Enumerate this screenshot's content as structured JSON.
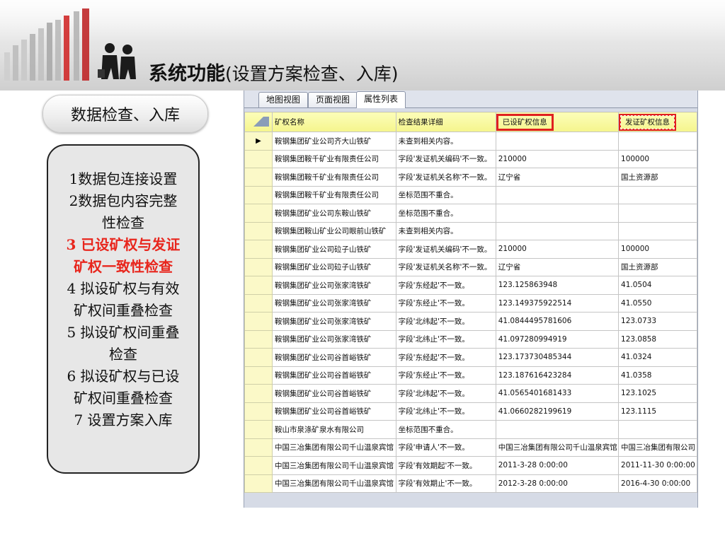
{
  "slide": {
    "title_bold": "系统功能",
    "title_rest": "(设置方案检查、入库)"
  },
  "section": {
    "label": "数据检查、入库"
  },
  "steps": [
    {
      "text": "1数据包连接设置",
      "highlight": false
    },
    {
      "text": "2数据包内容完整",
      "highlight": false
    },
    {
      "text": "性检查",
      "highlight": false
    },
    {
      "text": "3 已设矿权与发证",
      "highlight": true
    },
    {
      "text": "矿权一致性检查",
      "highlight": true
    },
    {
      "text": "4 拟设矿权与有效",
      "highlight": false
    },
    {
      "text": "矿权间重叠检查",
      "highlight": false
    },
    {
      "text": "5 拟设矿权间重叠",
      "highlight": false
    },
    {
      "text": "检查",
      "highlight": false
    },
    {
      "text": "6 拟设矿权与已设",
      "highlight": false
    },
    {
      "text": "矿权间重叠检查",
      "highlight": false
    },
    {
      "text": "7 设置方案入库",
      "highlight": false
    }
  ],
  "tabs": [
    {
      "label": "地图视图",
      "active": false
    },
    {
      "label": "页面视图",
      "active": false
    },
    {
      "label": "属性列表",
      "active": true
    }
  ],
  "table": {
    "columns": [
      "矿权名称",
      "检查结果详细",
      "已设矿权信息",
      "发证矿权信息"
    ],
    "current_row_marker": "▶",
    "rows": [
      [
        "鞍钢集团矿业公司齐大山铁矿",
        "未查到相关内容。",
        "",
        ""
      ],
      [
        "鞍钢集团鞍千矿业有限责任公司",
        "字段'发证机关编码'不一致。",
        "210000",
        "100000"
      ],
      [
        "鞍钢集团鞍千矿业有限责任公司",
        "字段'发证机关名称'不一致。",
        "辽宁省",
        "国土资源部"
      ],
      [
        "鞍钢集团鞍千矿业有限责任公司",
        "坐标范围不重合。",
        "",
        ""
      ],
      [
        "鞍钢集团矿业公司东鞍山铁矿",
        "坐标范围不重合。",
        "",
        ""
      ],
      [
        "鞍钢集团鞍山矿业公司眼前山铁矿",
        "未查到相关内容。",
        "",
        ""
      ],
      [
        "鞍钢集团矿业公司砬子山铁矿",
        "字段'发证机关编码'不一致。",
        "210000",
        "100000"
      ],
      [
        "鞍钢集团矿业公司砬子山铁矿",
        "字段'发证机关名称'不一致。",
        "辽宁省",
        "国土资源部"
      ],
      [
        "鞍钢集团矿业公司张家湾铁矿",
        "字段'东经起'不一致。",
        "123.125863948",
        "41.0504"
      ],
      [
        "鞍钢集团矿业公司张家湾铁矿",
        "字段'东经止'不一致。",
        "123.149375922514",
        "41.0550"
      ],
      [
        "鞍钢集团矿业公司张家湾铁矿",
        "字段'北纬起'不一致。",
        "41.0844495781606",
        "123.0733"
      ],
      [
        "鞍钢集团矿业公司张家湾铁矿",
        "字段'北纬止'不一致。",
        "41.097280994919",
        "123.0858"
      ],
      [
        "鞍钢集团矿业公司谷首峪铁矿",
        "字段'东经起'不一致。",
        "123.173730485344",
        "41.0324"
      ],
      [
        "鞍钢集团矿业公司谷首峪铁矿",
        "字段'东经止'不一致。",
        "123.187616423284",
        "41.0358"
      ],
      [
        "鞍钢集团矿业公司谷首峪铁矿",
        "字段'北纬起'不一致。",
        "41.0565401681433",
        "123.1025"
      ],
      [
        "鞍钢集团矿业公司谷首峪铁矿",
        "字段'北纬止'不一致。",
        "41.0660282199619",
        "123.1115"
      ],
      [
        "鞍山市泉涤矿泉水有限公司",
        "坐标范围不重合。",
        "",
        ""
      ],
      [
        "中国三冶集团有限公司千山温泉宾馆",
        "字段'申请人'不一致。",
        "中国三冶集团有限公司千山温泉宾馆",
        "中国三冶集团有限公司"
      ],
      [
        "中国三冶集团有限公司千山温泉宾馆",
        "字段'有效期起'不一致。",
        "2011-3-28 0:00:00",
        "2011-11-30 0:00:00"
      ],
      [
        "中国三冶集团有限公司千山温泉宾馆",
        "字段'有效期止'不一致。",
        "2012-3-28 0:00:00",
        "2016-4-30 0:00:00"
      ]
    ]
  },
  "colors": {
    "highlight_text": "#e8261d",
    "header_bg": "#f5f58c",
    "annotation_box": "#e02020"
  }
}
